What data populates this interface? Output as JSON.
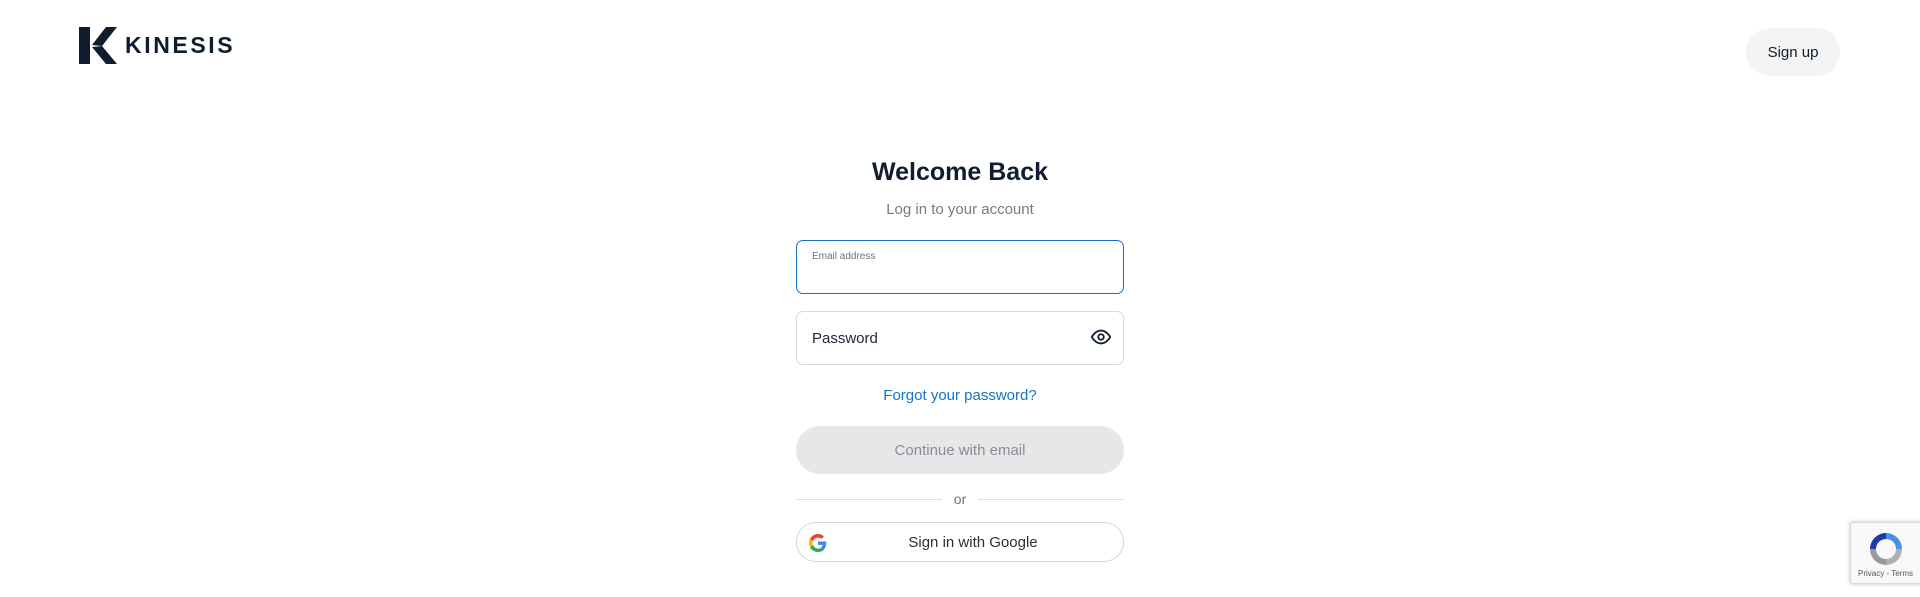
{
  "header": {
    "brand": "KINESIS",
    "signup_label": "Sign up"
  },
  "login": {
    "title": "Welcome Back",
    "subtitle": "Log in to your account",
    "email_label": "Email address",
    "email_value": "",
    "password_placeholder": "Password",
    "forgot_label": "Forgot your password?",
    "continue_label": "Continue with email",
    "divider_label": "or",
    "google_label": "Sign in with Google"
  },
  "recaptcha": {
    "privacy_label": "Privacy",
    "separator": " - ",
    "terms_label": "Terms"
  },
  "icons": {
    "logo": "kinesis-logo-icon",
    "password_toggle": "eye-icon",
    "google": "google-icon",
    "recaptcha": "recaptcha-icon"
  },
  "colors": {
    "brand_dark": "#0f1d2e",
    "accent_blue": "#1573c6",
    "disabled_button": "#e6e7e8",
    "signup_button_bg": "#f4f4f5"
  }
}
